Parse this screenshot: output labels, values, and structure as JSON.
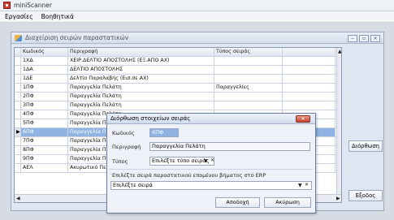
{
  "app": {
    "title": "miniScanner"
  },
  "menu": [
    "Εργασίες",
    "Βοηθητικά"
  ],
  "mdi": {
    "title": "Διαχείριση σειρών παραστατικών"
  },
  "grid": {
    "columns": [
      "Κωδικός",
      "Περιγραφή",
      "Τύπος σειράς"
    ],
    "rows": [
      {
        "code": "1ΧΔ",
        "desc": "ΧΕΙΡ.ΔΕΛΤΙΟ ΑΠΟΣΤΟΛΗΣ (ΕΞ.ΑΠΟ ΑΧ)",
        "type": ""
      },
      {
        "code": "1ΔΑ",
        "desc": "ΔΕΛΤΙΟ ΑΠΟΣΤΟΛΗΣ",
        "type": ""
      },
      {
        "code": "1ΔΕ",
        "desc": "Δελτίο Παραλαβής (Εισ.σε ΑΧ)",
        "type": ""
      },
      {
        "code": "1ΠΦ",
        "desc": "Παραγγελία Πελάτη",
        "type": "Παραγγελίες"
      },
      {
        "code": "2ΠΦ",
        "desc": "Παραγγελία Πελάτη",
        "type": ""
      },
      {
        "code": "3ΠΦ",
        "desc": "Παραγγελία Πελάτη",
        "type": ""
      },
      {
        "code": "4ΠΦ",
        "desc": "Παραγγελία Πελάτη",
        "type": ""
      },
      {
        "code": "5ΠΦ",
        "desc": "Παραγγελία Πελάτη",
        "type": ""
      },
      {
        "code": "6ΠΦ",
        "desc": "Παραγγελία Πελάτη",
        "type": ""
      },
      {
        "code": "7ΠΦ",
        "desc": "Παραγγελία Πελάτη",
        "type": ""
      },
      {
        "code": "8ΠΦ",
        "desc": "Παραγγελία Πελάτη",
        "type": ""
      },
      {
        "code": "9ΠΦ",
        "desc": "Παραγγελία Πελάτη",
        "type": ""
      },
      {
        "code": "ΑΕΛ",
        "desc": "Ακυρωτικό Πελ.",
        "type": ""
      }
    ],
    "selected_index": 8
  },
  "buttons": {
    "edit": "Διόρθωση",
    "exit": "Εξοδος"
  },
  "dialog": {
    "title": "Διόρθωση στοιχείων σειράς",
    "code_label": "Κωδικός",
    "code_value": "6ΠΦ",
    "desc_label": "Περιγραφή",
    "desc_value": "Παραγγελία Πελάτη",
    "type_label": "Τύπος",
    "type_placeholder": "Επιλέξτε τύπο σειράς",
    "erp_label": "Επιλέξτε σειρά παραστατικού επομένου βήματος στο ERP",
    "erp_placeholder": "Επιλέξτε σειρά",
    "ok": "Αποδοχή",
    "cancel": "Ακύρωση"
  },
  "colors": {
    "selection": "#8fb3e2",
    "close": "#c4432e"
  }
}
